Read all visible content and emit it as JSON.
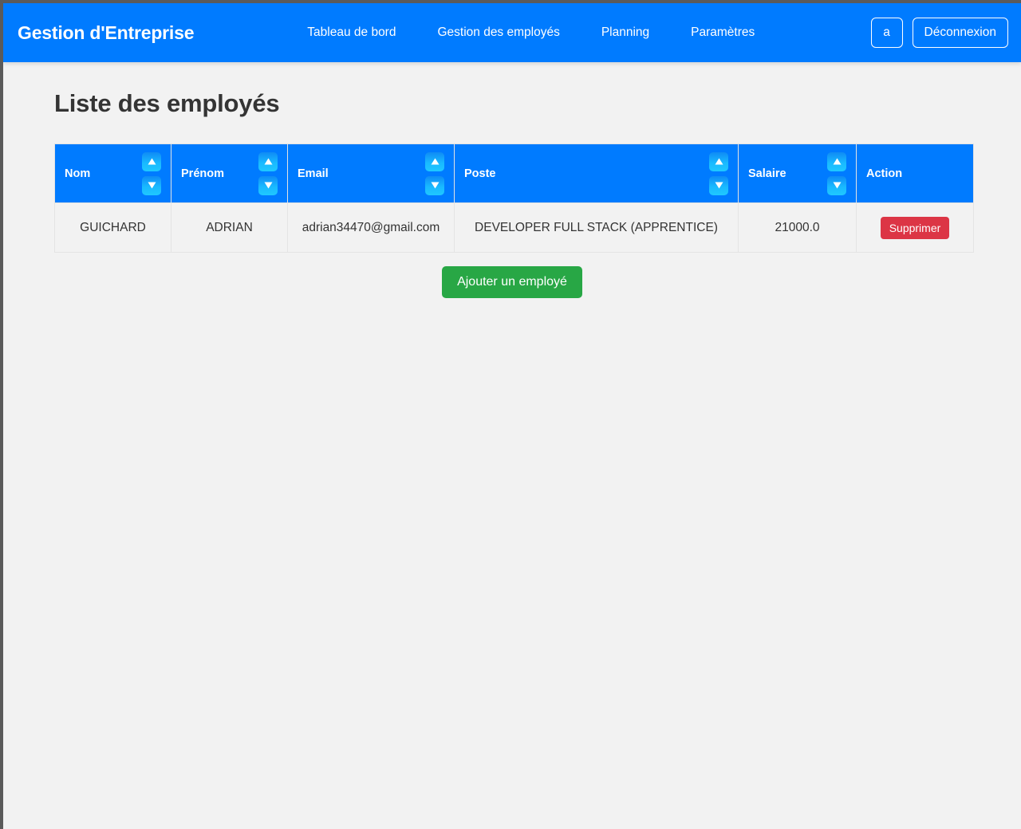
{
  "theme": {
    "primary": "#007bff",
    "danger": "#dc3545",
    "success": "#28a745",
    "page_background": "#f2f2f2",
    "frame": "#5a5a5a",
    "sort_button_top": "#0f8bf5",
    "sort_button_bottom": "#1fc8ff"
  },
  "navbar": {
    "brand": "Gestion d'Entreprise",
    "links": [
      {
        "label": "Tableau de bord"
      },
      {
        "label": "Gestion des employés"
      },
      {
        "label": "Planning"
      },
      {
        "label": "Paramètres"
      }
    ],
    "user_button": "a",
    "logout_button": "Déconnexion"
  },
  "main": {
    "title": "Liste des employés",
    "add_button": "Ajouter un employé"
  },
  "table": {
    "columns": [
      {
        "label": "Nom",
        "sortable": true,
        "align": "left"
      },
      {
        "label": "Prénom",
        "sortable": true,
        "align": "left"
      },
      {
        "label": "Email",
        "sortable": true,
        "align": "left"
      },
      {
        "label": "Poste",
        "sortable": true,
        "align": "left"
      },
      {
        "label": "Salaire",
        "sortable": true,
        "align": "left"
      },
      {
        "label": "Action",
        "sortable": false,
        "align": "center"
      }
    ],
    "sort_icons": {
      "ascending": "triangle-up-icon",
      "descending": "triangle-down-icon"
    },
    "rows": [
      {
        "nom": "GUICHARD",
        "prenom": "ADRIAN",
        "email": "adrian34470@gmail.com",
        "poste": "DEVELOPER FULL STACK (APPRENTICE)",
        "salaire": "21000.0",
        "action_label": "Supprimer"
      }
    ]
  }
}
